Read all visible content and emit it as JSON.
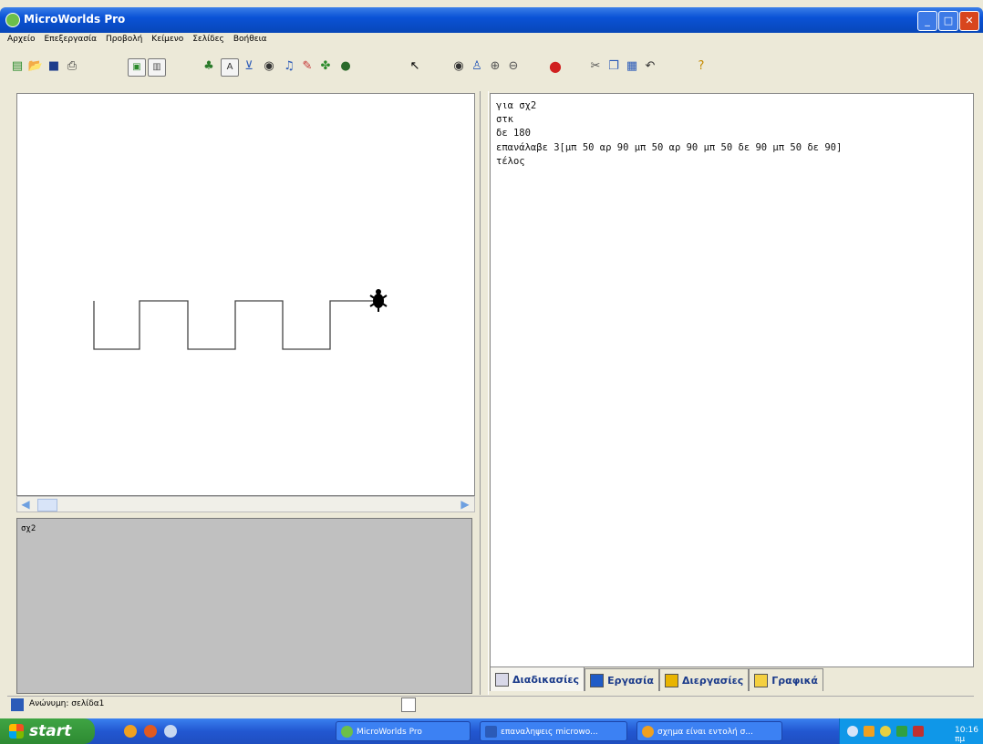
{
  "window": {
    "title": "MicroWorlds Pro",
    "minimize": "_",
    "maximize": "□",
    "close": "✕"
  },
  "menu": [
    "Αρχείο",
    "Επεξεργασία",
    "Προβολή",
    "Κείμενο",
    "Σελίδες",
    "Βοήθεια"
  ],
  "command_center": {
    "text": "σχ2"
  },
  "procedures": {
    "lines": [
      "για σχ2",
      "στκ",
      "δε 180",
      "επανάλαβε 3[μπ 50 αρ 90 μπ 50 αρ 90 μπ 50 δε 90 μπ 50 δε 90]",
      "τέλος"
    ]
  },
  "tabs": [
    {
      "label": "Διαδικασίες",
      "icon": "procedures-tab-icon",
      "color": "#d8d8e8"
    },
    {
      "label": "Εργασία",
      "icon": "project-tab-icon",
      "color": "#1f5bc6"
    },
    {
      "label": "Διεργασίες",
      "icon": "processes-tab-icon",
      "color": "#e8b400"
    },
    {
      "label": "Γραφικά",
      "icon": "graphics-tab-icon",
      "color": "#f4d040"
    }
  ],
  "status": {
    "text": "Ανώνυμη: σελίδα1"
  },
  "taskbar": {
    "start_label": "start",
    "tasks": [
      {
        "label": "MicroWorlds Pro",
        "icon_color": "#6cbf4a"
      },
      {
        "label": "επαναληψεις microwo...",
        "icon_color": "#2b5bb8"
      },
      {
        "label": "σχημα είναι εντολή σ...",
        "icon_color": "#f0a020"
      }
    ],
    "clock": "10:16 πμ"
  },
  "colors": {
    "titlebar": "#0a52d6",
    "taskbar": "#2257d1",
    "start": "#2d8a32",
    "command_bg": "#c0c0c0"
  }
}
